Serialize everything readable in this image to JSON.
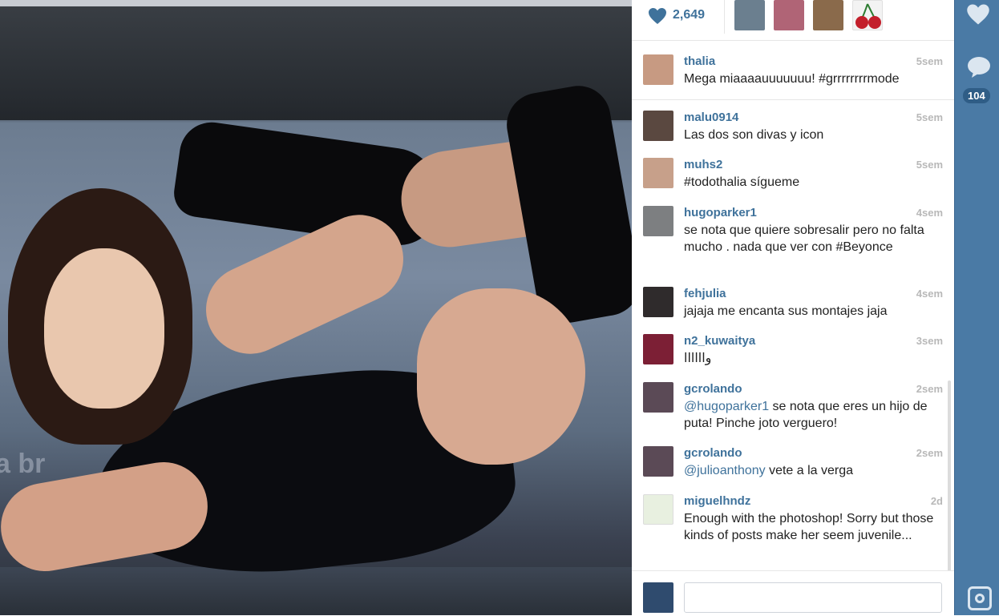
{
  "post": {
    "likes_count": "2,649",
    "likers": [
      {
        "avatar_color": "#6b7f8f"
      },
      {
        "avatar_color": "#b06476"
      },
      {
        "avatar_color": "#8a6a4b"
      },
      {
        "avatar_color": "#c31f2b"
      }
    ]
  },
  "caption": {
    "user": "thalia",
    "time": "5sem",
    "text": "Mega miaaaauuuuuuu! #grrrrrrrrmode",
    "avatar_color": "#c79a82"
  },
  "comments": [
    {
      "user": "malu0914",
      "time": "5sem",
      "text": "Las dos son divas y icon",
      "avatar_color": "#5a4840"
    },
    {
      "user": "muhs2",
      "time": "5sem",
      "text": "#todothalia sígueme",
      "avatar_color": "#c7a08a"
    },
    {
      "user": "hugoparker1",
      "time": "4sem",
      "text": "se nota que quiere sobresalir pero no falta mucho . nada que ver con #Beyonce",
      "avatar_color": "#7d7f81"
    },
    {
      "user": "fehjulia",
      "time": "4sem",
      "text": "jajaja me encanta sus montajes jaja",
      "avatar_color": "#2f2b2c"
    },
    {
      "user": "n2_kuwaitya",
      "time": "3sem",
      "text": "واااااا",
      "avatar_color": "#7c1f35"
    },
    {
      "user": "gcrolando",
      "time": "2sem",
      "mention": "@hugoparker1",
      "text": " se nota que eres un hijo de puta! Pinche joto verguero!",
      "avatar_color": "#5b4a56"
    },
    {
      "user": "gcrolando",
      "time": "2sem",
      "mention": "@julioanthony",
      "text": " vete a la verga",
      "avatar_color": "#5b4a56"
    },
    {
      "user": "miguelhndz",
      "time": "2d",
      "text": "Enough with the photoshop! Sorry but those kinds of posts make her seem juvenile...",
      "avatar_color": "#e8f0e0"
    }
  ],
  "comment_box": {
    "placeholder": "",
    "current_user_avatar_color": "#2f4b6e"
  },
  "rail": {
    "comments_count": "104"
  },
  "colors": {
    "link": "#3f729b",
    "rail": "#4a7aa5",
    "time": "#b8b8b8"
  },
  "icons": {
    "likes": "heart-icon",
    "rail_like": "heart-icon",
    "rail_comment": "speech-bubble-icon",
    "rail_camera": "camera-icon"
  }
}
